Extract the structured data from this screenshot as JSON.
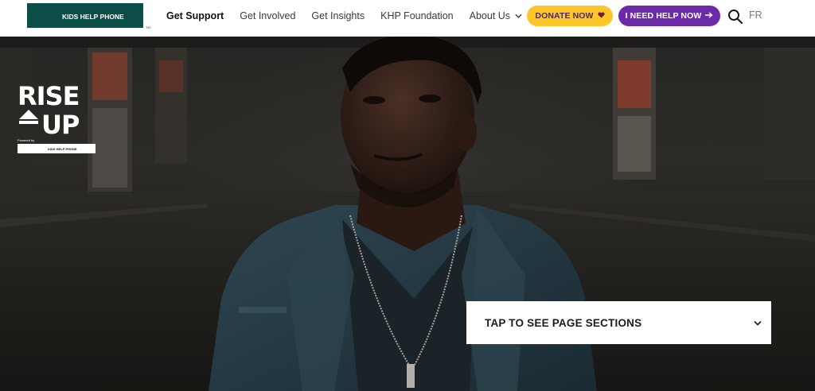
{
  "brand": {
    "logo_text": "KIDS HELP PHONE",
    "colors": {
      "teal": "#0d4d48",
      "yellow": "#ffc629",
      "purple": "#6d2aa8"
    }
  },
  "nav": {
    "items": [
      {
        "label": "Get Support",
        "active": true
      },
      {
        "label": "Get Involved",
        "active": false
      },
      {
        "label": "Get Insights",
        "active": false
      },
      {
        "label": "KHP Foundation",
        "active": false
      },
      {
        "label": "About Us",
        "active": false,
        "has_dropdown": true
      }
    ]
  },
  "actions": {
    "donate_label": "DONATE NOW",
    "donate_icon": "heart-icon",
    "help_label": "I NEED HELP NOW",
    "help_icon": "arrow-right-icon",
    "search_icon": "search-icon",
    "language_label": "FR"
  },
  "hero": {
    "campaign_logo": {
      "line1": "RISE",
      "line2": "UP",
      "powered_by": "Powered by",
      "sub_brand": "KIDS HELP PHONE"
    },
    "sections_toggle_label": "TAP TO SEE PAGE SECTIONS",
    "sections_toggle_icon": "chevron-down-icon"
  }
}
